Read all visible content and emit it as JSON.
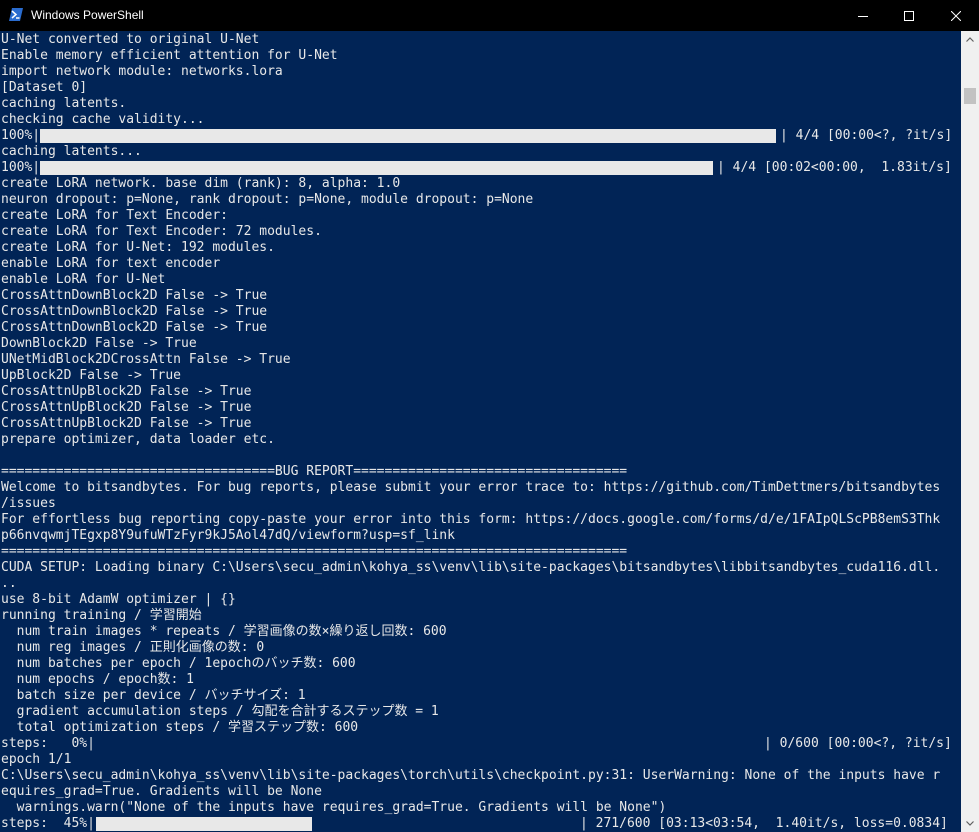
{
  "window": {
    "title": "Windows PowerShell",
    "icon": "powershell-icon",
    "colors": {
      "background": "#012456",
      "text": "#e8e8e8",
      "titlebar": "#000000"
    },
    "controls": [
      "minimize-icon",
      "maximize-icon",
      "close-icon"
    ]
  },
  "console": {
    "lines": [
      "U-Net converted to original U-Net",
      "Enable memory efficient attention for U-Net",
      "import network module: networks.lora",
      "[Dataset 0]",
      "caching latents.",
      "checking cache validity...",
      "100%|",
      "caching latents...",
      "100%|",
      "create LoRA network. base dim (rank): 8, alpha: 1.0",
      "neuron dropout: p=None, rank dropout: p=None, module dropout: p=None",
      "create LoRA for Text Encoder:",
      "create LoRA for Text Encoder: 72 modules.",
      "create LoRA for U-Net: 192 modules.",
      "enable LoRA for text encoder",
      "enable LoRA for U-Net",
      "CrossAttnDownBlock2D False -> True",
      "CrossAttnDownBlock2D False -> True",
      "CrossAttnDownBlock2D False -> True",
      "DownBlock2D False -> True",
      "UNetMidBlock2DCrossAttn False -> True",
      "UpBlock2D False -> True",
      "CrossAttnUpBlock2D False -> True",
      "CrossAttnUpBlock2D False -> True",
      "CrossAttnUpBlock2D False -> True",
      "prepare optimizer, data loader etc.",
      "",
      "===================================BUG REPORT===================================",
      "Welcome to bitsandbytes. For bug reports, please submit your error trace to: https://github.com/TimDettmers/bitsandbytes",
      "/issues",
      "For effortless bug reporting copy-paste your error into this form: https://docs.google.com/forms/d/e/1FAIpQLScPB8emS3Thk",
      "p66nvqwmjTEgxp8Y9ufuWTzFyr9kJ5Aol47dQ/viewform?usp=sf_link",
      "================================================================================",
      "CUDA SETUP: Loading binary C:\\Users\\secu_admin\\kohya_ss\\venv\\lib\\site-packages\\bitsandbytes\\libbitsandbytes_cuda116.dll.",
      "..",
      "use 8-bit AdamW optimizer | {}",
      "running training / 学習開始",
      "  num train images * repeats / 学習画像の数×繰り返し回数: 600",
      "  num reg images / 正則化画像の数: 0",
      "  num batches per epoch / 1epochのバッチ数: 600",
      "  num epochs / epoch数: 1",
      "  batch size per device / バッチサイズ: 1",
      "  gradient accumulation steps / 勾配を合計するステップ数 = 1",
      "  total optimization steps / 学習ステップ数: 600",
      "steps:   0%|",
      "epoch 1/1",
      "C:\\Users\\secu_admin\\kohya_ss\\venv\\lib\\site-packages\\torch\\utils\\checkpoint.py:31: UserWarning: None of the inputs have r",
      "equires_grad=True. Gradients will be None",
      "  warnings.warn(\"None of the inputs have requires_grad=True. Gradients will be None\")",
      "steps:  45%|"
    ],
    "progress": [
      {
        "line": 6,
        "fraction": 1.0,
        "suffix": "| 4/4 [00:00<?, ?it/s]"
      },
      {
        "line": 8,
        "fraction": 1.0,
        "suffix": "| 4/4 [00:02<00:00,  1.83it/s]"
      },
      {
        "line": 44,
        "fraction": 0.0,
        "suffix": "| 0/600 [00:00<?, ?it/s]"
      },
      {
        "line": 49,
        "fraction": 0.45,
        "suffix": "| 271/600 [03:13<03:54,  1.40it/s, loss=0.0834]"
      }
    ]
  },
  "scrollbar": {
    "up": "scroll-up-arrow-icon",
    "down": "scroll-down-arrow-icon",
    "position": 0.95
  }
}
